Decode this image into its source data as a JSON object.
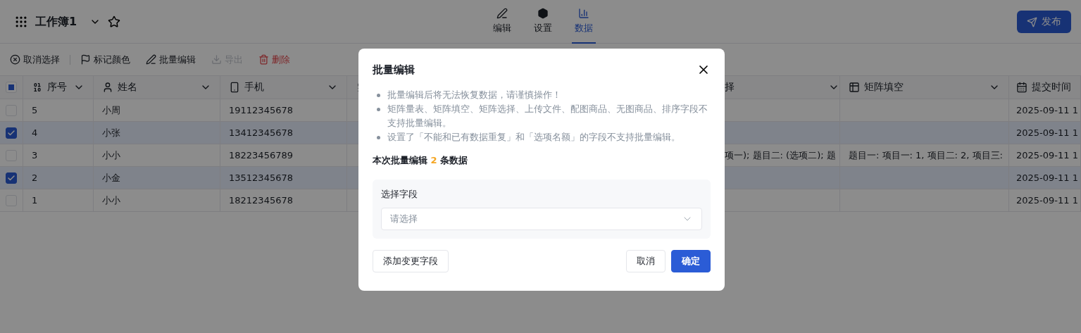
{
  "header": {
    "title": "工作簿1",
    "tabs": [
      {
        "label": "编辑",
        "kind": "edit",
        "selected": false
      },
      {
        "label": "设置",
        "kind": "settings",
        "selected": false
      },
      {
        "label": "数据",
        "kind": "data",
        "selected": true
      }
    ],
    "publish_button": "发布"
  },
  "toolbar": [
    {
      "label": "取消选择",
      "kind": "cancel",
      "disabled": false
    },
    {
      "label": "标记颜色",
      "kind": "flag",
      "disabled": false
    },
    {
      "label": "批量编辑",
      "kind": "edit",
      "disabled": false
    },
    {
      "label": "导出",
      "kind": "export",
      "disabled": true
    },
    {
      "label": "删除",
      "kind": "delete",
      "disabled": false
    }
  ],
  "table": {
    "select_all_indeterminate": true,
    "columns": [
      {
        "label": "序号",
        "kind": "number"
      },
      {
        "label": "姓名",
        "kind": "person"
      },
      {
        "label": "手机",
        "kind": "phone"
      },
      {
        "kind": "number"
      },
      {
        "label": "择",
        "kind": "none"
      },
      {
        "label": "矩阵填空",
        "kind": "matrix"
      },
      {
        "label": "提交时间",
        "kind": "date"
      }
    ],
    "rows": [
      {
        "selected": false,
        "cells": [
          "5",
          "小周",
          "19112345678",
          "",
          "",
          "",
          "2025-09-11 1"
        ]
      },
      {
        "selected": true,
        "cells": [
          "4",
          "小张",
          "13412345678",
          "",
          "",
          "",
          "2025-09-11 1"
        ]
      },
      {
        "selected": false,
        "cells": [
          "3",
          "小小",
          "18223456789",
          "",
          "项一); 题目二: (选项二); 题",
          "题目一: 项目一: 1, 项目二: 2, 项目三:",
          "2025-09-11 1"
        ]
      },
      {
        "selected": true,
        "cells": [
          "2",
          "小金",
          "13512345678",
          "",
          "",
          "",
          "2025-09-11 1"
        ]
      },
      {
        "selected": false,
        "cells": [
          "1",
          "小小",
          "18212345678",
          "",
          "",
          "",
          "2025-09-11 1"
        ]
      }
    ]
  },
  "dialog": {
    "title": "批量编辑",
    "notes": [
      "批量编辑后将无法恢复数据，请谨慎操作！",
      "矩阵量表、矩阵填空、矩阵选择、上传文件、配图商品、无图商品、排序字段不支持批量编辑。",
      "设置了「不能和已有数据重复」和「选项名额」的字段不支持批量编辑。"
    ],
    "summary": {
      "prefix": "本次批量编辑",
      "count": "2",
      "suffix": "条数据"
    },
    "field": {
      "label": "选择字段",
      "placeholder": "请选择"
    },
    "add_button": "添加变更字段",
    "cancel_button": "取消",
    "confirm_button": "确定"
  }
}
